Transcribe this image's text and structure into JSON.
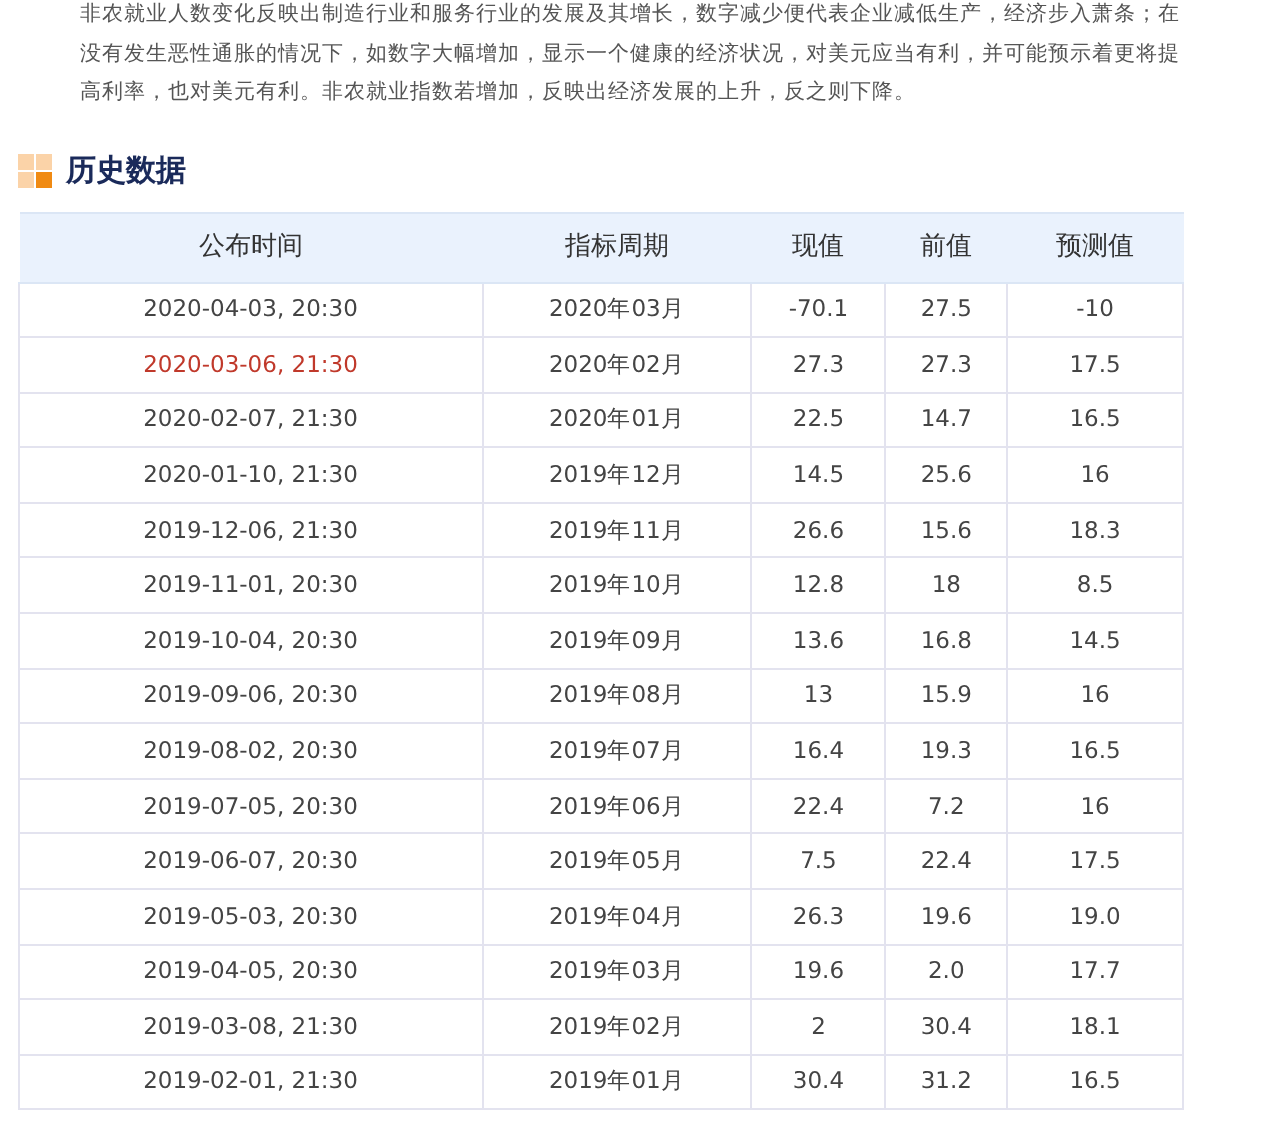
{
  "intro": "非农就业人数变化反映出制造行业和服务行业的发展及其增长，数字减少便代表企业减低生产，经济步入萧条；在没有发生恶性通胀的情况下，如数字大幅增加，显示一个健康的经济状况，对美元应当有利，并可能预示着更将提高利率，也对美元有利。非农就业指数若增加，反映出经济发展的上升，反之则下降。",
  "section_title": "历史数据",
  "table": {
    "columns": [
      "公布时间",
      "指标周期",
      "现值",
      "前值",
      "预测值"
    ],
    "rows": [
      {
        "cells": [
          "2020-04-03, 20:30",
          "2020年03月",
          "-70.1",
          "27.5",
          "-10"
        ],
        "highlighted": false
      },
      {
        "cells": [
          "2020-03-06, 21:30",
          "2020年02月",
          "27.3",
          "27.3",
          "17.5"
        ],
        "highlighted": true
      },
      {
        "cells": [
          "2020-02-07, 21:30",
          "2020年01月",
          "22.5",
          "14.7",
          "16.5"
        ],
        "highlighted": false
      },
      {
        "cells": [
          "2020-01-10, 21:30",
          "2019年12月",
          "14.5",
          "25.6",
          "16"
        ],
        "highlighted": false
      },
      {
        "cells": [
          "2019-12-06, 21:30",
          "2019年11月",
          "26.6",
          "15.6",
          "18.3"
        ],
        "highlighted": false
      },
      {
        "cells": [
          "2019-11-01, 20:30",
          "2019年10月",
          "12.8",
          "18",
          "8.5"
        ],
        "highlighted": false
      },
      {
        "cells": [
          "2019-10-04, 20:30",
          "2019年09月",
          "13.6",
          "16.8",
          "14.5"
        ],
        "highlighted": false
      },
      {
        "cells": [
          "2019-09-06, 20:30",
          "2019年08月",
          "13",
          "15.9",
          "16"
        ],
        "highlighted": false
      },
      {
        "cells": [
          "2019-08-02, 20:30",
          "2019年07月",
          "16.4",
          "19.3",
          "16.5"
        ],
        "highlighted": false
      },
      {
        "cells": [
          "2019-07-05, 20:30",
          "2019年06月",
          "22.4",
          "7.2",
          "16"
        ],
        "highlighted": false
      },
      {
        "cells": [
          "2019-06-07, 20:30",
          "2019年05月",
          "7.5",
          "22.4",
          "17.5"
        ],
        "highlighted": false
      },
      {
        "cells": [
          "2019-05-03, 20:30",
          "2019年04月",
          "26.3",
          "19.6",
          "19.0"
        ],
        "highlighted": false
      },
      {
        "cells": [
          "2019-04-05, 20:30",
          "2019年03月",
          "19.6",
          "2.0",
          "17.7"
        ],
        "highlighted": false
      },
      {
        "cells": [
          "2019-03-08, 21:30",
          "2019年02月",
          "2",
          "30.4",
          "18.1"
        ],
        "highlighted": false
      },
      {
        "cells": [
          "2019-02-01, 21:30",
          "2019年01月",
          "30.4",
          "31.2",
          "16.5"
        ],
        "highlighted": false
      }
    ]
  }
}
